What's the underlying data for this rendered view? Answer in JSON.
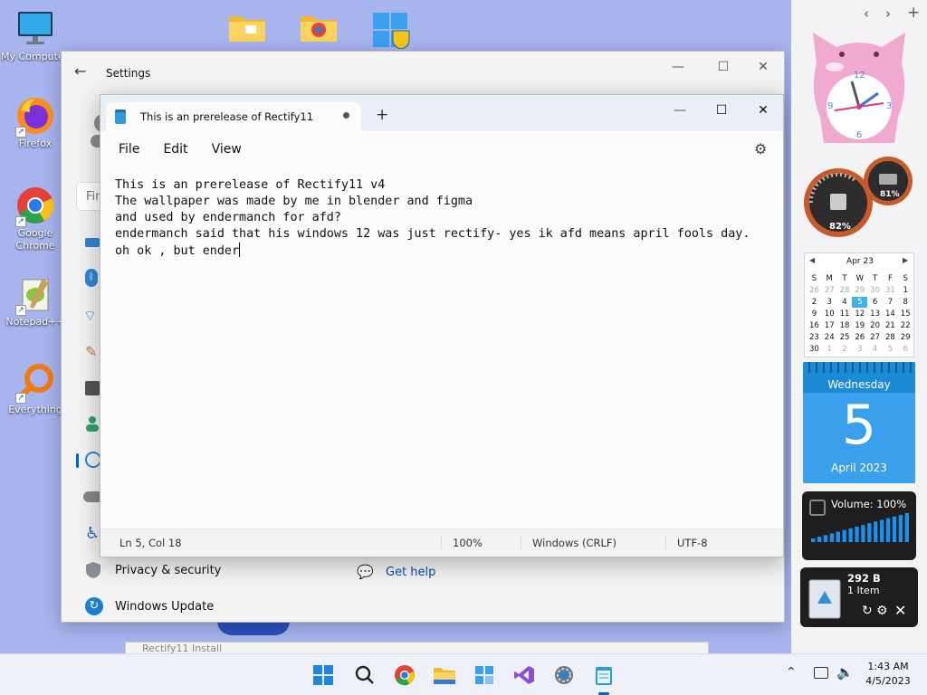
{
  "desktop": {
    "icons": [
      {
        "label": "My Computer"
      },
      {
        "label": "Firefox"
      },
      {
        "label": "Google Chrome"
      },
      {
        "label": "Notepad++"
      },
      {
        "label": "Everything"
      }
    ]
  },
  "settings": {
    "title": "Settings",
    "search_placeholder": "Fin",
    "nav_privacy": "Privacy & security",
    "nav_update": "Windows Update",
    "get_help": "Get help"
  },
  "notepad": {
    "tab_title": "This is an prerelease of Rectify11",
    "menu": {
      "file": "File",
      "edit": "Edit",
      "view": "View"
    },
    "lines": [
      "This is an prerelease of Rectify11 v4",
      "The wallpaper was made by me in blender and figma",
      "and used by endermanch for afd?",
      "endermanch said that his windows 12 was just rectify- yes ik afd means april fools day.",
      "oh ok , but ender"
    ],
    "status": {
      "position": "Ln 5, Col 18",
      "zoom": "100%",
      "line_ending": "Windows (CRLF)",
      "encoding": "UTF-8"
    }
  },
  "background_window_text": "Rectify11 Install",
  "gadgets": {
    "clock": {
      "n12": "12",
      "n3": "3",
      "n6": "6",
      "n9": "9"
    },
    "meters": {
      "cpu": "82%",
      "ram": "81%"
    },
    "calendar": {
      "month": "Apr 23",
      "weekdays": [
        "S",
        "M",
        "T",
        "W",
        "T",
        "F",
        "S"
      ],
      "weeks": [
        [
          "26",
          "27",
          "28",
          "29",
          "30",
          "31",
          "1"
        ],
        [
          "2",
          "3",
          "4",
          "5",
          "6",
          "7",
          "8"
        ],
        [
          "9",
          "10",
          "11",
          "12",
          "13",
          "14",
          "15"
        ],
        [
          "16",
          "17",
          "18",
          "19",
          "20",
          "21",
          "22"
        ],
        [
          "23",
          "24",
          "25",
          "26",
          "27",
          "28",
          "29"
        ],
        [
          "30",
          "1",
          "2",
          "3",
          "4",
          "5",
          "6"
        ]
      ],
      "today": "5"
    },
    "date": {
      "weekday": "Wednesday",
      "day": "5",
      "month_year": "April 2023"
    },
    "volume": {
      "label": "Volume: 100%",
      "level": 1.0
    },
    "recycle": {
      "size": "292 B",
      "items": "1 Item"
    }
  },
  "taskbar": {
    "time": "1:43 AM",
    "date": "4/5/2023"
  }
}
